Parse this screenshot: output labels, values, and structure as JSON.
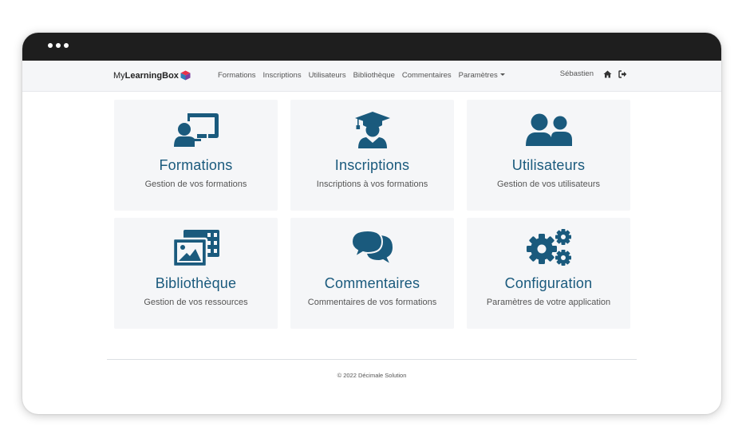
{
  "brand": {
    "prefix": "My",
    "name": "LearningBox"
  },
  "nav": {
    "links": [
      "Formations",
      "Inscriptions",
      "Utilisateurs",
      "Bibliothèque",
      "Commentaires"
    ],
    "dropdown_label": "Paramètres",
    "user": "Sébastien"
  },
  "cards": [
    {
      "title": "Formations",
      "desc": "Gestion de vos formations",
      "icon": "chalkboard-teacher-icon"
    },
    {
      "title": "Inscriptions",
      "desc": "Inscriptions à vos formations",
      "icon": "graduate-icon"
    },
    {
      "title": "Utilisateurs",
      "desc": "Gestion de vos utilisateurs",
      "icon": "users-icon"
    },
    {
      "title": "Bibliothèque",
      "desc": "Gestion de vos ressources",
      "icon": "photo-video-icon"
    },
    {
      "title": "Commentaires",
      "desc": "Commentaires de vos formations",
      "icon": "comments-icon"
    },
    {
      "title": "Configuration",
      "desc": "Paramètres de votre application",
      "icon": "cogs-icon"
    }
  ],
  "footer": {
    "text": "© 2022 Décimale Solution"
  },
  "colors": {
    "accent": "#1a5a7d",
    "titlebar": "#1e1e1e",
    "card_bg": "#f5f6f8"
  }
}
